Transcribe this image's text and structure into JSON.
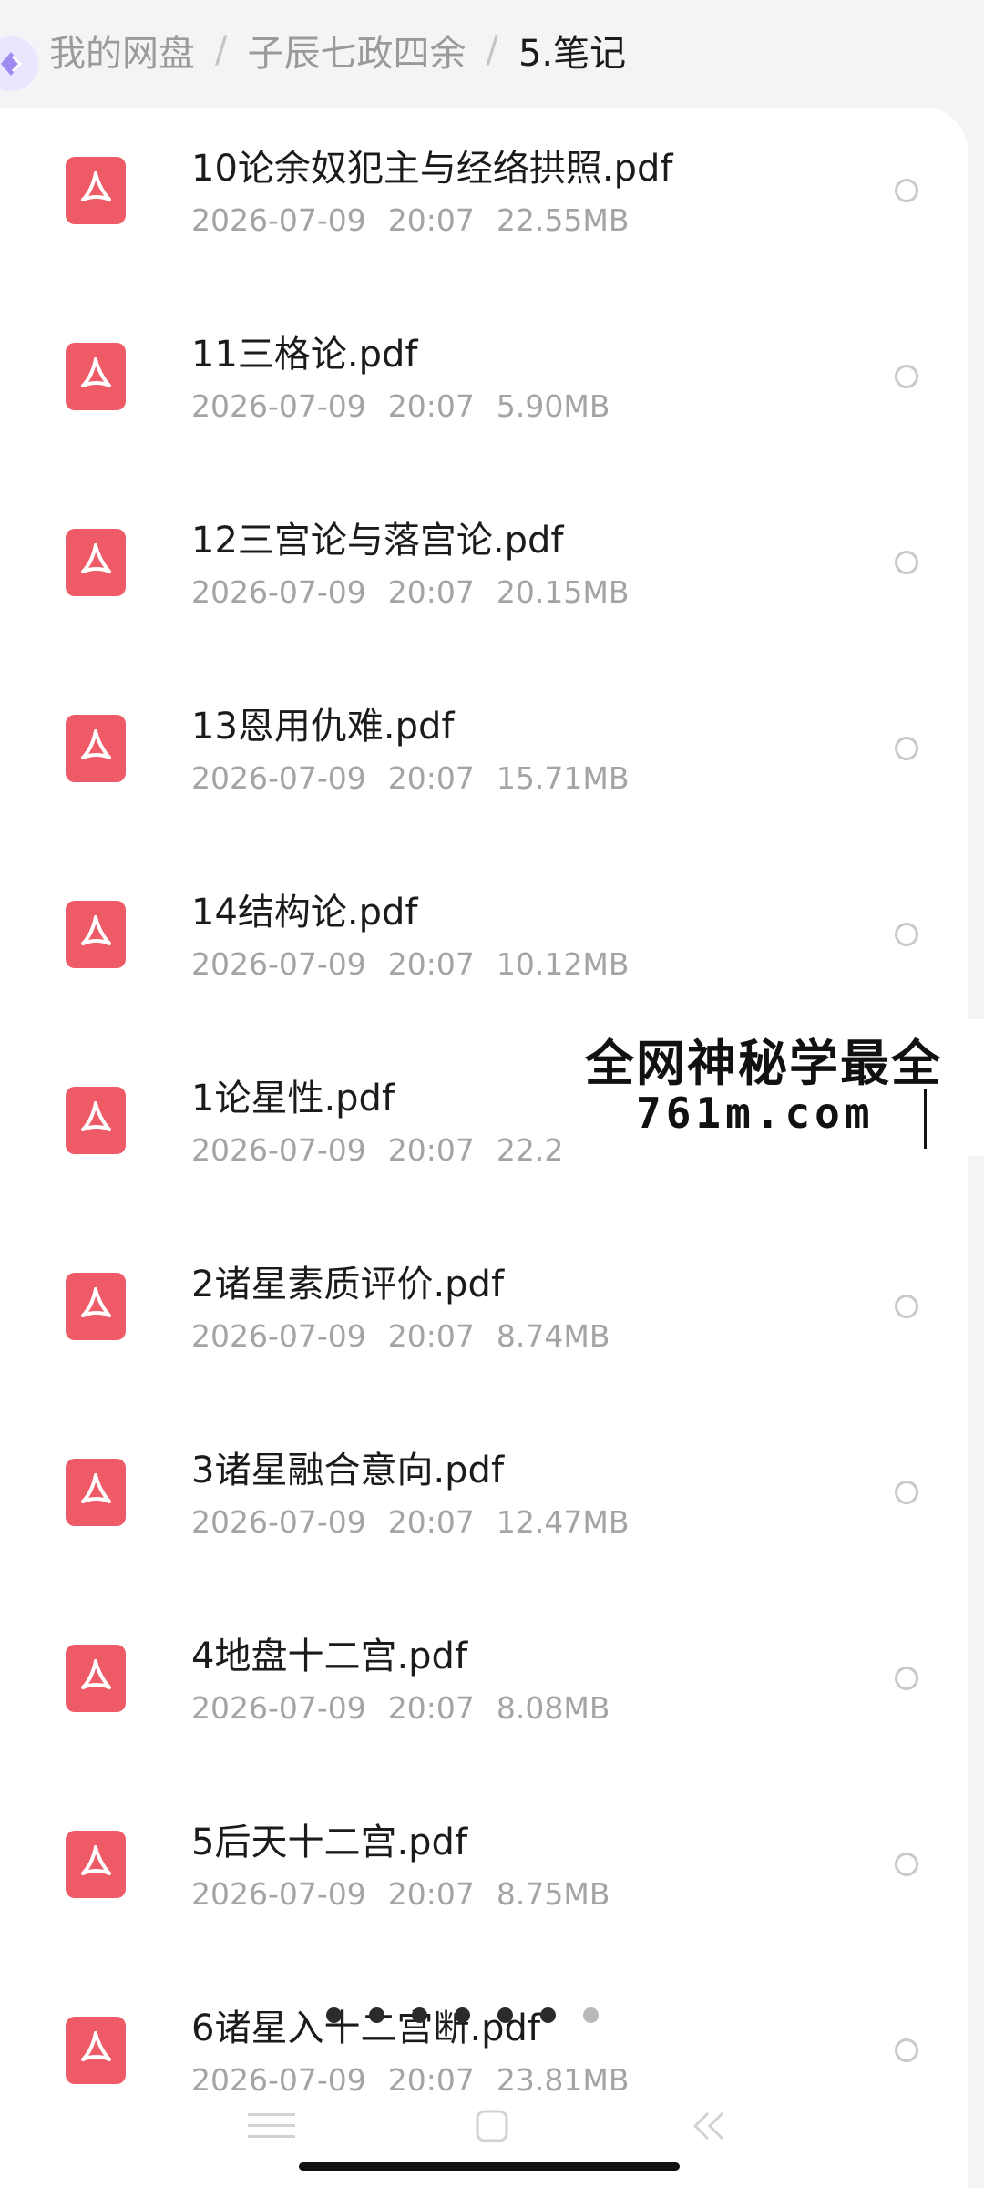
{
  "breadcrumb": {
    "items": [
      "我的网盘",
      "子辰七政四余",
      "5.笔记"
    ],
    "separator": "/"
  },
  "files": [
    {
      "name": "10论余奴犯主与经络拱照.pdf",
      "date": "2026-07-09",
      "time": "20:07",
      "size": "22.55MB"
    },
    {
      "name": "11三格论.pdf",
      "date": "2026-07-09",
      "time": "20:07",
      "size": "5.90MB"
    },
    {
      "name": "12三宫论与落宫论.pdf",
      "date": "2026-07-09",
      "time": "20:07",
      "size": "20.15MB"
    },
    {
      "name": "13恩用仇难.pdf",
      "date": "2026-07-09",
      "time": "20:07",
      "size": "15.71MB"
    },
    {
      "name": "14结构论.pdf",
      "date": "2026-07-09",
      "time": "20:07",
      "size": "10.12MB"
    },
    {
      "name": "1论星性.pdf",
      "date": "2026-07-09",
      "time": "20:07",
      "size": "22.2"
    },
    {
      "name": "2诸星素质评价.pdf",
      "date": "2026-07-09",
      "time": "20:07",
      "size": "8.74MB"
    },
    {
      "name": "3诸星融合意向.pdf",
      "date": "2026-07-09",
      "time": "20:07",
      "size": "12.47MB"
    },
    {
      "name": "4地盘十二宫.pdf",
      "date": "2026-07-09",
      "time": "20:07",
      "size": "8.08MB"
    },
    {
      "name": "5后天十二宫.pdf",
      "date": "2026-07-09",
      "time": "20:07",
      "size": "8.75MB"
    },
    {
      "name": "6诸星入十二宫断.pdf",
      "date": "2026-07-09",
      "time": "20:07",
      "size": "23.81MB"
    }
  ],
  "watermark": {
    "line1": "全网神秘学最全",
    "line2": "761m.com"
  },
  "icons": {
    "file": "pdf-icon",
    "select": "radio-circle-icon",
    "nav_menu": "menu-icon",
    "nav_home": "home-square-icon",
    "nav_back": "back-chevron-icon"
  },
  "colors": {
    "pdf_red": "#ee5a66",
    "background": "#f3f4f6",
    "card": "#ffffff",
    "secondary_text": "#a4a4a4"
  }
}
